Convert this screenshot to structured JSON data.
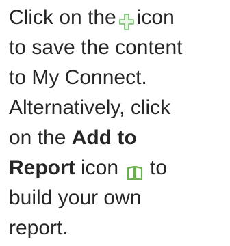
{
  "instructions": {
    "line1": {
      "before_icon": "Click on the",
      "after_icon": "icon"
    },
    "line2": "to save the content",
    "line3": "to My Connect.",
    "line4": "Alternatively, click",
    "line5": {
      "prefix": "on the ",
      "bold": "Add to"
    },
    "line6": {
      "bold": "Report",
      "middle": " icon",
      "after_icon": "to"
    },
    "line7": "build your own",
    "line8": "report."
  },
  "icons": {
    "save_icon": "plus-cross-icon",
    "add_to_report_icon": "open-book-icon"
  },
  "colors": {
    "text": "#262626",
    "save_icon": "#7cc576",
    "add_to_report_icon": "#6ab04c"
  }
}
